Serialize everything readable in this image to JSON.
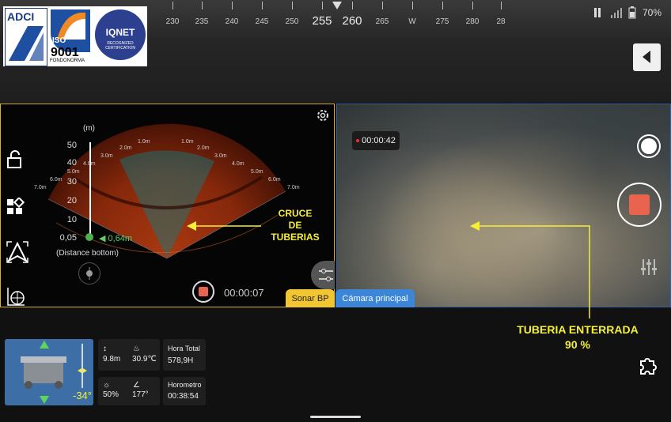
{
  "logos": {
    "adci": "ADCI",
    "iso_top": "ISO",
    "iso_number": "9001",
    "iso_bottom": "FONDONORMA",
    "iqnet": "IQNET",
    "iqnet_sub": "RECOGNIZED CERTIFICATION"
  },
  "compass": {
    "labels": [
      "230",
      "235",
      "240",
      "245",
      "250",
      "255",
      "260",
      "265",
      "W",
      "275",
      "280",
      "28"
    ],
    "big_labels": [
      "255",
      "260"
    ]
  },
  "status": {
    "battery": "70%"
  },
  "sonar": {
    "unit_label": "(m)",
    "scale_values": [
      "50",
      "40",
      "30",
      "20",
      "10",
      "0,05"
    ],
    "distance_value": "0,64m",
    "distance_caption": "(Distance bottom)",
    "range_arc_labels": [
      "1.0m",
      "2.0m",
      "3.0m",
      "4.0m",
      "5.0m",
      "6.0m",
      "7.0m"
    ],
    "record_time": "00:00:07"
  },
  "annotations": {
    "crossing": [
      "CRUCE",
      "DE",
      "TUBERIAS"
    ],
    "buried_title": "TUBERIA ENTERRADA",
    "buried_pct": "90 %"
  },
  "camera": {
    "timer": "00:00:42"
  },
  "tabs": {
    "sonar": "Sonar BP",
    "camera": "Cámara principal"
  },
  "telemetry": {
    "attitude_angle": "-34°",
    "depth": "9.8m",
    "temperature": "30.9℃",
    "light": "50%",
    "heading": "177°",
    "total_hours_label": "Hora Total",
    "total_hours_value": "578,9H",
    "horometer_label": "Horometro",
    "horometer_value": "00:38:54"
  },
  "icons": [
    "lock-icon",
    "apps-icon",
    "auto-pilot-icon",
    "map-grid-icon",
    "settings-gear-icon",
    "filter-sliders-icon",
    "snapshot-icon",
    "record-icon",
    "puzzle-icon",
    "back-arrow-icon",
    "signal-icon",
    "battery-icon"
  ]
}
